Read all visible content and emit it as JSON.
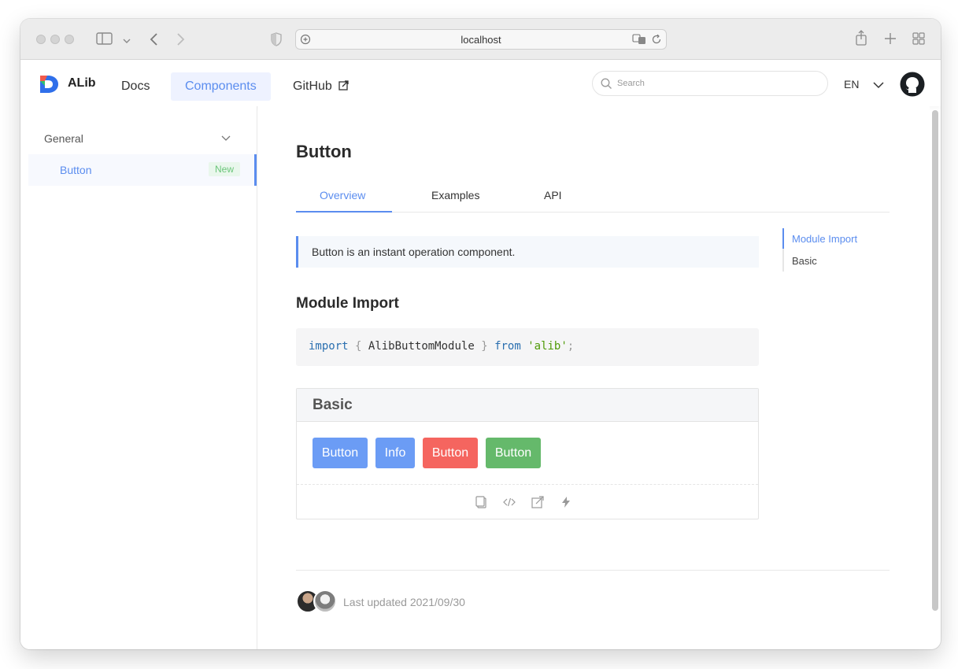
{
  "browser": {
    "url": "localhost"
  },
  "header": {
    "brand": "ALib",
    "nav": [
      {
        "label": "Docs"
      },
      {
        "label": "Components"
      },
      {
        "label": "GitHub"
      }
    ],
    "search_placeholder": "Search",
    "language": "EN"
  },
  "sidebar": {
    "group": "General",
    "items": [
      {
        "label": "Button",
        "badge": "New"
      }
    ]
  },
  "main": {
    "title": "Button",
    "tabs": [
      "Overview",
      "Examples",
      "API"
    ],
    "callout": "Button is an instant operation component.",
    "section_title": "Module Import",
    "code": {
      "kw1": "import",
      "brace_open": "{",
      "identifier": "AlibButtomModule",
      "brace_close": "}",
      "kw2": "from",
      "string": "'alib'",
      "semicolon": ";"
    },
    "demo": {
      "title": "Basic",
      "buttons": [
        {
          "label": "Button",
          "color": "#6b9cf5"
        },
        {
          "label": "Info",
          "color": "#6b9cf5"
        },
        {
          "label": "Button",
          "color": "#f5655f"
        },
        {
          "label": "Button",
          "color": "#65b96b"
        }
      ]
    },
    "last_updated": "Last updated 2021/09/30"
  },
  "toc": {
    "items": [
      "Module Import",
      "Basic"
    ]
  },
  "colors": {
    "accent": "#5b8def",
    "badge_green": "#6bc57a"
  }
}
